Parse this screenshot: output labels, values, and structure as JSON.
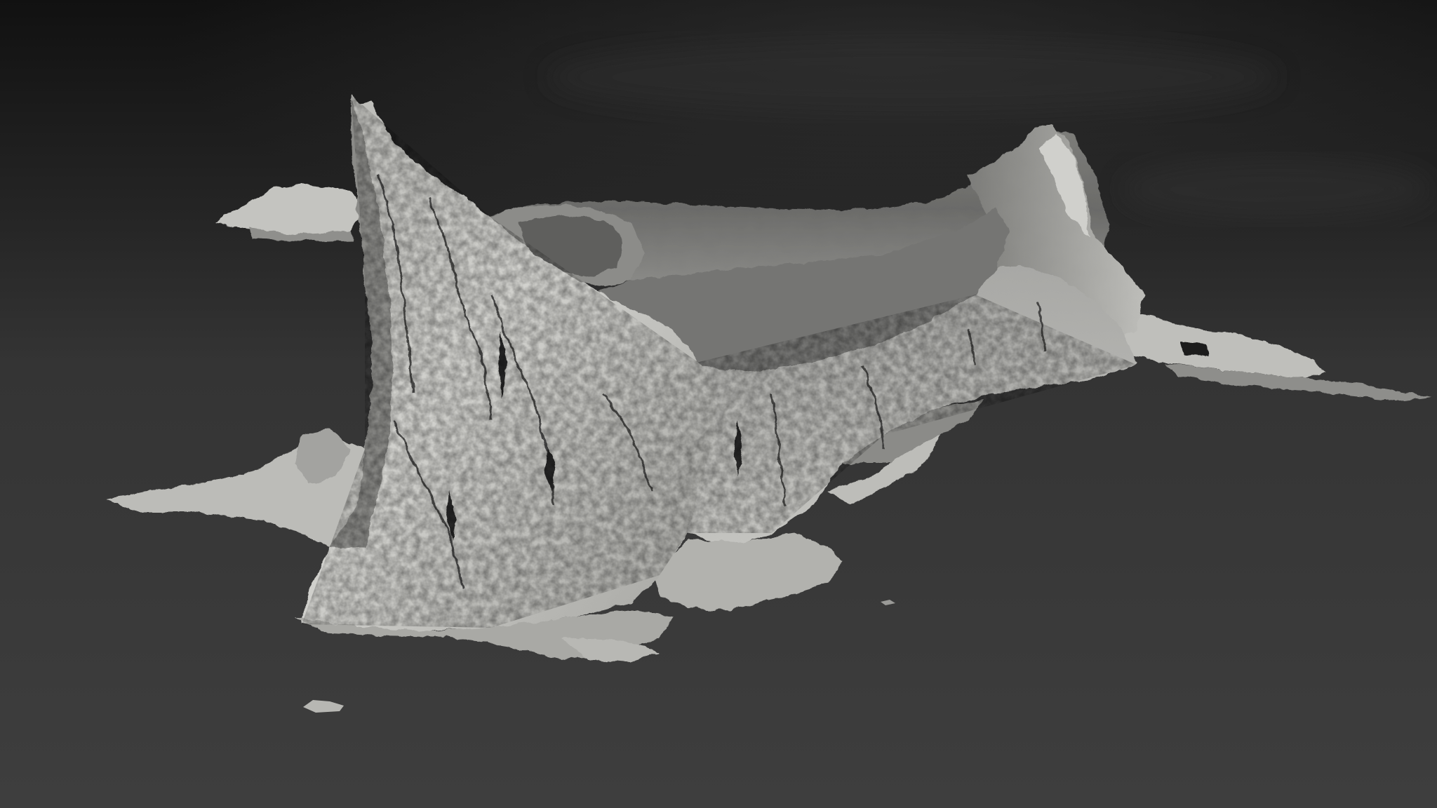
{
  "scene": {
    "subject": "3d-terrain-mesh-render",
    "colors": {
      "sky_top": "#121212",
      "sky_mid": "#2a2a2a",
      "ground": "#3d3d3d",
      "ground_far": "#333333",
      "mesh_light": "#c8c8c4",
      "mesh_mid": "#9a9a97",
      "mesh_shadow": "#5e5e5c",
      "mesh_dark": "#3a3a39",
      "cliff_crack": "#2a2a29"
    }
  }
}
